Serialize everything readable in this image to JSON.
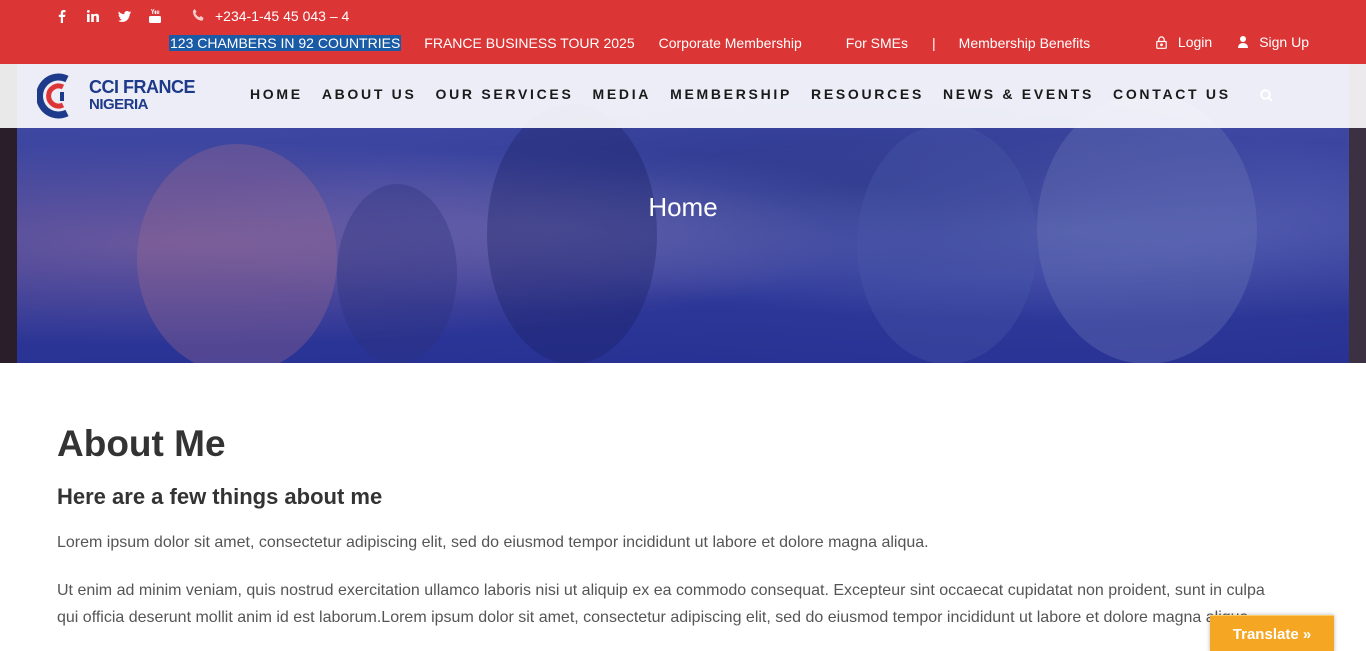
{
  "topbar": {
    "social_icons": [
      "facebook-icon",
      "linkedin-icon",
      "twitter-icon",
      "youtube-icon"
    ],
    "phone": "+234-1-45 45 043 – 4",
    "links": [
      "123 CHAMBERS IN 92 COUNTRIES",
      "FRANCE BUSINESS TOUR 2025",
      "Corporate Membership",
      "For SMEs",
      "|",
      "Membership Benefits"
    ],
    "login": "Login",
    "signup": "Sign Up",
    "colors": {
      "bar": "#dc3535",
      "selection": "#1b5ba6"
    }
  },
  "logo": {
    "line1": "CCI FRANCE",
    "line2": "NIGERIA"
  },
  "nav": {
    "items": [
      "HOME",
      "ABOUT US",
      "OUR SERVICES",
      "MEDIA",
      "MEMBERSHIP",
      "RESOURCES",
      "NEWS & EVENTS",
      "CONTACT US"
    ],
    "search_icon": "search-icon"
  },
  "hero": {
    "title": "Home"
  },
  "main": {
    "heading": "About Me",
    "subheading": "Here are a few things about me",
    "paragraph1": "Lorem ipsum dolor sit amet, consectetur adipiscing elit, sed do eiusmod tempor incididunt ut labore et dolore magna aliqua.",
    "paragraph2": "Ut enim ad minim veniam, quis nostrud exercitation ullamco laboris nisi ut aliquip ex ea commodo consequat.  Excepteur sint occaecat cupidatat non proident, sunt in culpa qui officia deserunt mollit anim id est laborum.Lorem ipsum dolor sit amet, consectetur adipiscing elit, sed do eiusmod tempor incididunt ut labore et dolore magna aliqua."
  },
  "translate": {
    "label": "Translate »",
    "color": "#f5a623"
  }
}
